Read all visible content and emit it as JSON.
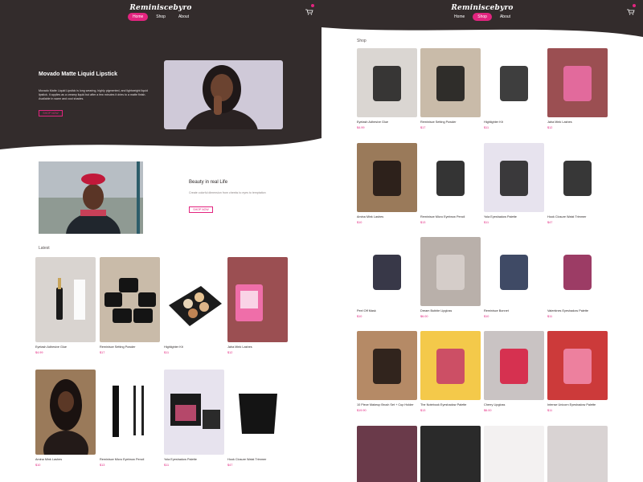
{
  "brand": "Reminiscebyro",
  "nav": {
    "links": [
      "Home",
      "Shop",
      "About"
    ],
    "left_active": "Home",
    "right_active": "Shop"
  },
  "hero": {
    "title": "Movado Matte Liquid Lipstick",
    "text": "Movado Matte Liquid Lipstick is long wearing, highly pigmented, and lightweight liquid lipstick. It applies as a creamy liquid but after a few minutes it dries to a matte finish. Available in warm and cool shades.",
    "button": "SHOP NOW"
  },
  "beauty": {
    "title": "Beauty in real Life",
    "text": "Create colorful dimension from cheeks to eyes to temptation",
    "button": "SHOP NOW"
  },
  "latest_label": "Latest",
  "shop_label": "Shop",
  "latest_products": [
    {
      "name": "Eyelash Adhesive Glue",
      "price": "$4.99"
    },
    {
      "name": "Reminisce Setting Powder",
      "price": "$17"
    },
    {
      "name": "Highlighter Kit",
      "price": "$11"
    },
    {
      "name": "Jaha Mink Lashes",
      "price": "$12"
    },
    {
      "name": "Amina Mink Lashes",
      "price": "$10"
    },
    {
      "name": "Reminisce Micro Eyebrow Pencil",
      "price": "$13"
    },
    {
      "name": "Yola Eyeshadow Palette",
      "price": "$11"
    },
    {
      "name": "Hook Closure Waist Trimmer",
      "price": "$47"
    }
  ],
  "shop_products": [
    {
      "name": "Eyelash Adhesive Glue",
      "price": "$4.99"
    },
    {
      "name": "Reminisce Setting Powder",
      "price": "$17"
    },
    {
      "name": "Highlighter Kit",
      "price": "$11"
    },
    {
      "name": "Jaha Mink Lashes",
      "price": "$12"
    },
    {
      "name": "Amina Mink Lashes",
      "price": "$10"
    },
    {
      "name": "Reminisce Micro Eyebrow Pencil",
      "price": "$13"
    },
    {
      "name": "Yola Eyeshadow Palette",
      "price": "$11"
    },
    {
      "name": "Hook Closure Waist Trimmer",
      "price": "$47"
    },
    {
      "name": "Peel Off Mask",
      "price": "$10"
    },
    {
      "name": "Dream Bubble Lipgloss",
      "price": "$6.00"
    },
    {
      "name": "Reminisce Bonnet",
      "price": "$10"
    },
    {
      "name": "Valentines Eyeshadow Palette",
      "price": "$11"
    },
    {
      "name": "10 Piece Makeup Brush Set + Cup Holder",
      "price": "$19.90"
    },
    {
      "name": "The Notebook Eyeshadow Palette",
      "price": "$13"
    },
    {
      "name": "Cherry Lipgloss",
      "price": "$6.00"
    },
    {
      "name": "Intense Unicorn Eyeshadow Palette",
      "price": "$11"
    }
  ],
  "colors": {
    "dark": "#332c2c",
    "accent": "#e2247f"
  },
  "icons": {
    "cart": "shopping-cart-icon"
  }
}
